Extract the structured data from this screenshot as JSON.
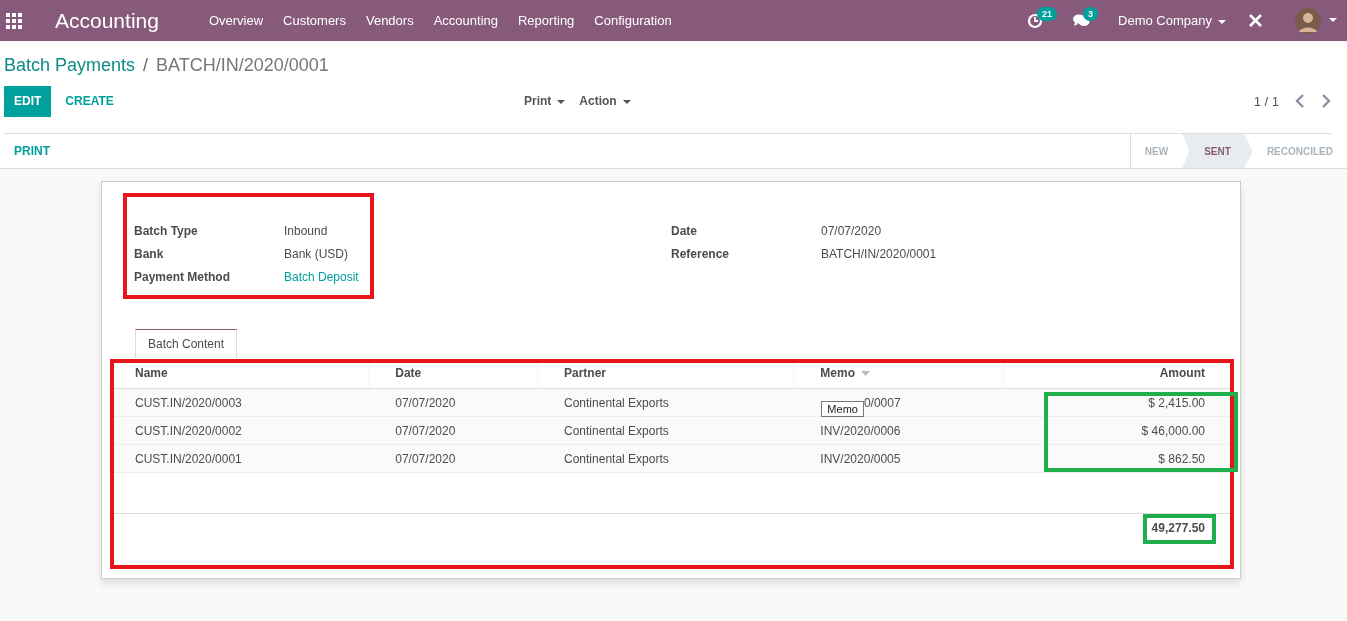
{
  "navbar": {
    "app": "Accounting",
    "menu": [
      "Overview",
      "Customers",
      "Vendors",
      "Accounting",
      "Reporting",
      "Configuration"
    ],
    "activity_count": "21",
    "message_count": "3",
    "company": "Demo Company"
  },
  "breadcrumb": {
    "parent": "Batch Payments",
    "separator": "/",
    "current": "BATCH/IN/2020/0001"
  },
  "buttons": {
    "edit": "EDIT",
    "create": "CREATE",
    "print": "Print",
    "action": "Action"
  },
  "pager": "1 / 1",
  "header_button": "PRINT",
  "stages": [
    {
      "label": "NEW",
      "selected": false
    },
    {
      "label": "SENT",
      "selected": true
    },
    {
      "label": "RECONCILED",
      "selected": false
    }
  ],
  "fields_left": [
    {
      "label": "Batch Type",
      "value": "Inbound",
      "kind": "text"
    },
    {
      "label": "Bank",
      "value": "Bank (USD)",
      "kind": "text"
    },
    {
      "label": "Payment Method",
      "value": "Batch Deposit",
      "kind": "link"
    }
  ],
  "fields_right": [
    {
      "label": "Date",
      "value": "07/07/2020"
    },
    {
      "label": "Reference",
      "value": "BATCH/IN/2020/0001"
    }
  ],
  "tab": {
    "label": "Batch Content",
    "selected": true
  },
  "table": {
    "columns": [
      "Name",
      "Date",
      "Partner",
      "Memo",
      "Amount"
    ],
    "rows": [
      [
        "CUST.IN/2020/0003",
        "07/07/2020",
        "Continental Exports",
        "0/0007",
        "$ 2,415.00"
      ],
      [
        "CUST.IN/2020/0002",
        "07/07/2020",
        "Continental Exports",
        "INV/2020/0006",
        "$ 46,000.00"
      ],
      [
        "CUST.IN/2020/0001",
        "07/07/2020",
        "Continental Exports",
        "INV/2020/0005",
        "$ 862.50"
      ]
    ],
    "total": "49,277.50",
    "tooltip": "Memo"
  },
  "highlights": [
    {
      "color": "#e8141c"
    },
    {
      "color": "#e8141c"
    },
    {
      "color": "#1fae4b"
    },
    {
      "color": "#1fae4b"
    }
  ]
}
